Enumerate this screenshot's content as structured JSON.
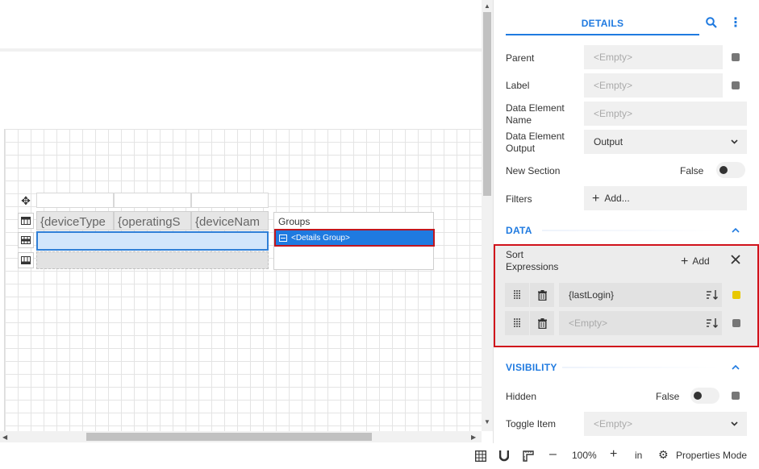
{
  "canvas": {
    "columns": [
      "{deviceType",
      "{operatingS",
      "{deviceNam"
    ],
    "groups_title": "Groups",
    "group_item": "<Details Group>"
  },
  "panel": {
    "tab": "DETAILS",
    "parent_label": "Parent",
    "parent_value": "<Empty>",
    "label_label": "Label",
    "label_value": "<Empty>",
    "den_label_1": "Data Element",
    "den_label_2": "Name",
    "den_value": "<Empty>",
    "deo_label_1": "Data Element",
    "deo_label_2": "Output",
    "deo_value": "Output",
    "new_section_label": "New Section",
    "new_section_value": "False",
    "filters_label": "Filters",
    "filters_add": "Add...",
    "data_section": "DATA",
    "sort_label_1": "Sort",
    "sort_label_2": "Expressions",
    "sort_add": "Add",
    "sort_items": [
      {
        "value": "{lastLogin}",
        "color": "#e8c800"
      },
      {
        "value": "<Empty>",
        "color": "#777777"
      }
    ],
    "visibility_section": "VISIBILITY",
    "hidden_label": "Hidden",
    "hidden_value": "False",
    "toggle_item_label": "Toggle Item",
    "toggle_item_value": "<Empty>"
  },
  "toolbar": {
    "zoom": "100%",
    "unit": "in",
    "properties_mode": "Properties Mode"
  },
  "colors": {
    "accent": "#1f7ae0",
    "highlight_border": "#d0121b"
  }
}
